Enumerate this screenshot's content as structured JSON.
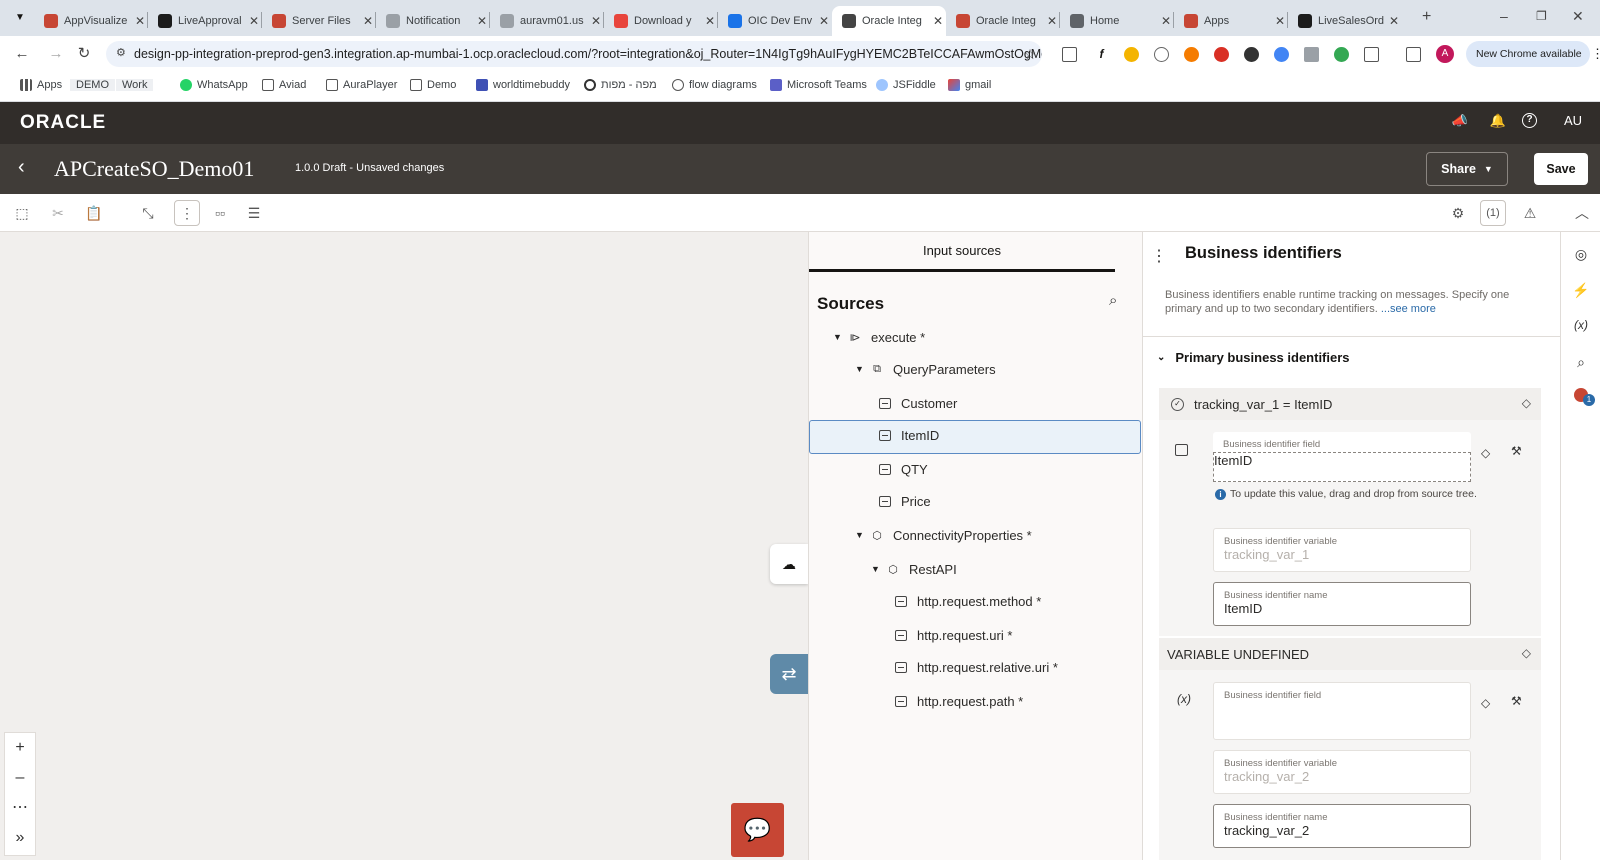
{
  "browser": {
    "tabs": [
      {
        "title": "AppVisualize",
        "color": "#c74634"
      },
      {
        "title": "LiveApproval",
        "color": "#1c1c1c"
      },
      {
        "title": "Server Files",
        "color": "#c74634"
      },
      {
        "title": "Notification",
        "color": "#9aa0a6"
      },
      {
        "title": "auravm01.us",
        "color": "#9aa0a6"
      },
      {
        "title": "Download y",
        "color": "#e8453c"
      },
      {
        "title": "OIC Dev Env",
        "color": "#1a73e8"
      },
      {
        "title": "Oracle Integ",
        "color": "#444444"
      },
      {
        "title": "Oracle Integ",
        "color": "#c74634"
      },
      {
        "title": "Home",
        "color": "#5f6368"
      },
      {
        "title": "Apps",
        "color": "#c74634"
      },
      {
        "title": "LiveSalesOrd",
        "color": "#1c1c1c"
      }
    ],
    "url": "design-pp-integration-preprod-gen3.integration.ap-mumbai-1.ocp.oraclecloud.com/?root=integration&oj_Router=1N4IgTg9hAuIFygHYEMC2BTeICCAFAwmOstOgMoDyA...",
    "new_chrome": "New Chrome available",
    "profile_initial": "A",
    "bookmarks": [
      "Apps",
      "DEMO",
      "Work",
      "WhatsApp",
      "Aviad",
      "AuraPlayer",
      "Demo",
      "worldtimebuddy",
      "מפה - מפות",
      "flow diagrams",
      "Microsoft Teams",
      "JSFiddle",
      "gmail"
    ]
  },
  "oracle": {
    "logo": "ORACLE",
    "user_initials": "AU",
    "integration_name": "APCreateSO_Demo01",
    "status": "1.0.0 Draft - Unsaved changes",
    "share_label": "Share",
    "save_label": "Save"
  },
  "sources": {
    "tab_label": "Input sources",
    "title": "Sources",
    "nodes": [
      {
        "label": "execute *",
        "level": 0,
        "kind": "root"
      },
      {
        "label": "QueryParameters",
        "level": 1,
        "kind": "group"
      },
      {
        "label": "Customer",
        "level": 2,
        "kind": "field"
      },
      {
        "label": "ItemID",
        "level": 2,
        "kind": "field"
      },
      {
        "label": "QTY",
        "level": 2,
        "kind": "field"
      },
      {
        "label": "Price",
        "level": 2,
        "kind": "field"
      },
      {
        "label": "ConnectivityProperties *",
        "level": 1,
        "kind": "object"
      },
      {
        "label": "RestAPI",
        "level": 2,
        "kind": "object"
      },
      {
        "label": "http.request.method *",
        "level": 3,
        "kind": "field"
      },
      {
        "label": "http.request.uri *",
        "level": 3,
        "kind": "field"
      },
      {
        "label": "http.request.relative.uri *",
        "level": 3,
        "kind": "field"
      },
      {
        "label": "http.request.path *",
        "level": 3,
        "kind": "field"
      }
    ]
  },
  "business": {
    "title": "Business identifiers",
    "description": "Business identifiers enable runtime tracking on messages. Specify one primary and up to two secondary identifiers.",
    "see_more": "...see more",
    "primary_section": "Primary business identifiers",
    "primary": {
      "header": "tracking_var_1 = ItemID",
      "field_label": "Business identifier field",
      "field_value": "ItemID",
      "info": "To update this value, drag and drop from source tree.",
      "variable_label": "Business identifier variable",
      "variable_value": "tracking_var_1",
      "name_label": "Business identifier name",
      "name_value": "ItemID"
    },
    "secondary": {
      "header": "VARIABLE UNDEFINED",
      "field_label": "Business identifier field",
      "field_value": "",
      "variable_label": "Business identifier variable",
      "variable_value": "tracking_var_2",
      "name_label": "Business identifier name",
      "name_value": "tracking_var_2"
    }
  }
}
